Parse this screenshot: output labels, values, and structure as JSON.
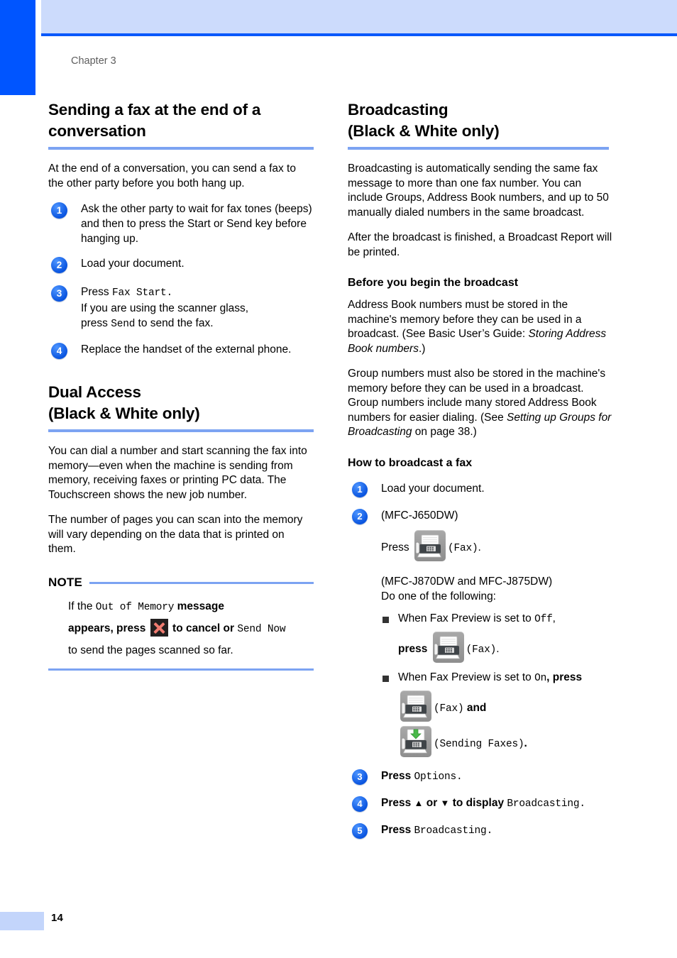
{
  "page": {
    "chapter_label": "Chapter 3",
    "page_number": "14",
    "accent_dark_blue": "#0055ff",
    "accent_light_blue": "#ccdbfc",
    "rule_blue": "#7ca3f2",
    "step_badge_blue": "#1263e0"
  },
  "left_column": {
    "section1": {
      "heading_line1": "Sending a fax at the end of a",
      "heading_line2": "conversation",
      "intro": "At the end of a conversation, you can send a fax to the other party before you both hang up.",
      "steps": [
        {
          "num": "1",
          "text": "Ask the other party to wait for fax tones (beeps) and then to press the Start or Send key before hanging up."
        },
        {
          "num": "2",
          "text": "Load your document."
        },
        {
          "num": "3",
          "line1_prefix": "Press ",
          "line1_mono": "Fax Start.",
          "line2": "If you are using the scanner glass,",
          "line3_prefix": "press ",
          "line3_mono": "Send",
          "line3_suffix": " to send the fax."
        },
        {
          "num": "4",
          "text": "Replace the handset of the external phone."
        }
      ]
    },
    "section2": {
      "heading_line1": "Dual Access",
      "heading_line2": "(Black & White only)",
      "para1": "You can dial a number and start scanning the fax into memory—even when the machine is sending from memory, receiving faxes or printing PC data. The Touchscreen shows the new job number.",
      "para2": "The number of pages you can scan into the memory will vary depending on the data that is printed on them."
    },
    "note": {
      "title": "NOTE",
      "line1_prefix": "If the ",
      "line1_mono": "Out of Memory",
      "line1_suffix": " message",
      "line2_prefix": "appears, press ",
      "line2_icon": "cancel-icon",
      "line2_mid": " to cancel or ",
      "line2_mono": "Send Now",
      "line3": "to send the pages scanned so far."
    }
  },
  "right_column": {
    "section1": {
      "heading_line1": "Broadcasting",
      "heading_line2": "(Black & White only)",
      "para1": "Broadcasting is automatically sending the same fax message to more than one fax number. You can include Groups, Address Book numbers, and up to 50 manually dialed numbers in the same broadcast.",
      "para2": "After the broadcast is finished, a Broadcast Report will be printed."
    },
    "before_begin": {
      "heading": "Before you begin the broadcast",
      "para1_a": "Address Book numbers must be stored in the machine's memory before they can be used in a broadcast. (See Basic User’s Guide: ",
      "para1_italic": "Storing Address Book numbers",
      "para1_b": ".)",
      "para2_a": "Group numbers must also be stored in the machine's memory before they can be used in a broadcast. Group numbers include many stored Address Book numbers for easier dialing. (See ",
      "para2_italic": "Setting up Groups for Broadcasting",
      "para2_b": " on page 38.)"
    },
    "how_to": {
      "heading": "How to broadcast a fax",
      "step1": {
        "num": "1",
        "text": "Load your document."
      },
      "step2": {
        "num": "2",
        "model_a": "(MFC-J650DW)",
        "press_prefix": "Press ",
        "press_icon": "fax-icon",
        "press_suffix_mono": "(Fax)",
        "press_suffix_period": ".",
        "model_b_line1": "(MFC-J870DW and MFC-J875DW)",
        "model_b_line2": "Do one of the following:",
        "bullets": [
          {
            "text_a": "When Fax Preview is set to ",
            "mono_1": "Off",
            "text_b": ",",
            "press_prefix": "press ",
            "icon": "fax-icon",
            "mono_2": "(Fax)",
            "period": "."
          },
          {
            "text_a": "When Fax Preview is set to ",
            "mono_1": "On",
            "text_b": ", press",
            "icon_1": "fax-icon",
            "mono_2": "(Fax)",
            "text_c": " and",
            "icon_2": "sending-faxes-icon",
            "mono_3": "(Sending Faxes)",
            "period": "."
          }
        ]
      },
      "step3": {
        "num": "3",
        "prefix": "Press ",
        "mono": "Options.",
        "suffix": ""
      },
      "step4": {
        "num": "4",
        "prefix": "Press ",
        "up_arrow": "▲",
        "mid": " or ",
        "down_arrow": "▼",
        "mid2": " to display ",
        "mono": "Broadcasting."
      },
      "step5": {
        "num": "5",
        "prefix": "Press ",
        "mono": "Broadcasting."
      }
    }
  }
}
